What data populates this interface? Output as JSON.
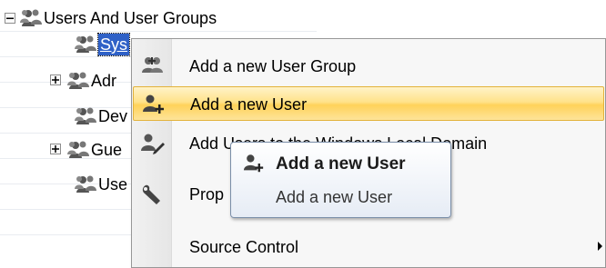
{
  "tree": {
    "root": {
      "label": "Users And User Groups",
      "expander": "minus",
      "icon": "user-group-icon"
    },
    "children": [
      {
        "label": "Sys",
        "expander": null,
        "selected": true,
        "icon": "user-group-icon"
      },
      {
        "label": "Adr",
        "expander": "plus",
        "selected": false,
        "icon": "user-group-icon"
      },
      {
        "label": "Dev",
        "expander": null,
        "selected": false,
        "icon": "user-group-icon"
      },
      {
        "label": "Gue",
        "expander": "plus",
        "selected": false,
        "icon": "user-group-icon"
      },
      {
        "label": "Use",
        "expander": null,
        "selected": false,
        "icon": "user-group-icon"
      }
    ]
  },
  "context_menu": {
    "items": [
      {
        "label": "Add a new User Group",
        "icon": "add-user-group-icon",
        "highlighted": false,
        "has_submenu": false
      },
      {
        "label": "Add a new User",
        "icon": "add-user-icon",
        "highlighted": true,
        "has_submenu": false
      },
      {
        "label": "Add Users to the Windows Local Domain",
        "icon": "users-pencil-icon",
        "highlighted": false,
        "has_submenu": false
      },
      {
        "label": "Prop",
        "icon": "wrench-icon",
        "highlighted": false,
        "has_submenu": false
      },
      {
        "label": "Source Control",
        "icon": null,
        "highlighted": false,
        "has_submenu": true
      }
    ]
  },
  "tooltip": {
    "title": "Add a new User",
    "description": "Add a new User",
    "icon": "add-user-icon"
  },
  "colors": {
    "selection": "#2f61c7",
    "menu_highlight": "#ffd25a",
    "tooltip_border": "#7a8ea8"
  }
}
